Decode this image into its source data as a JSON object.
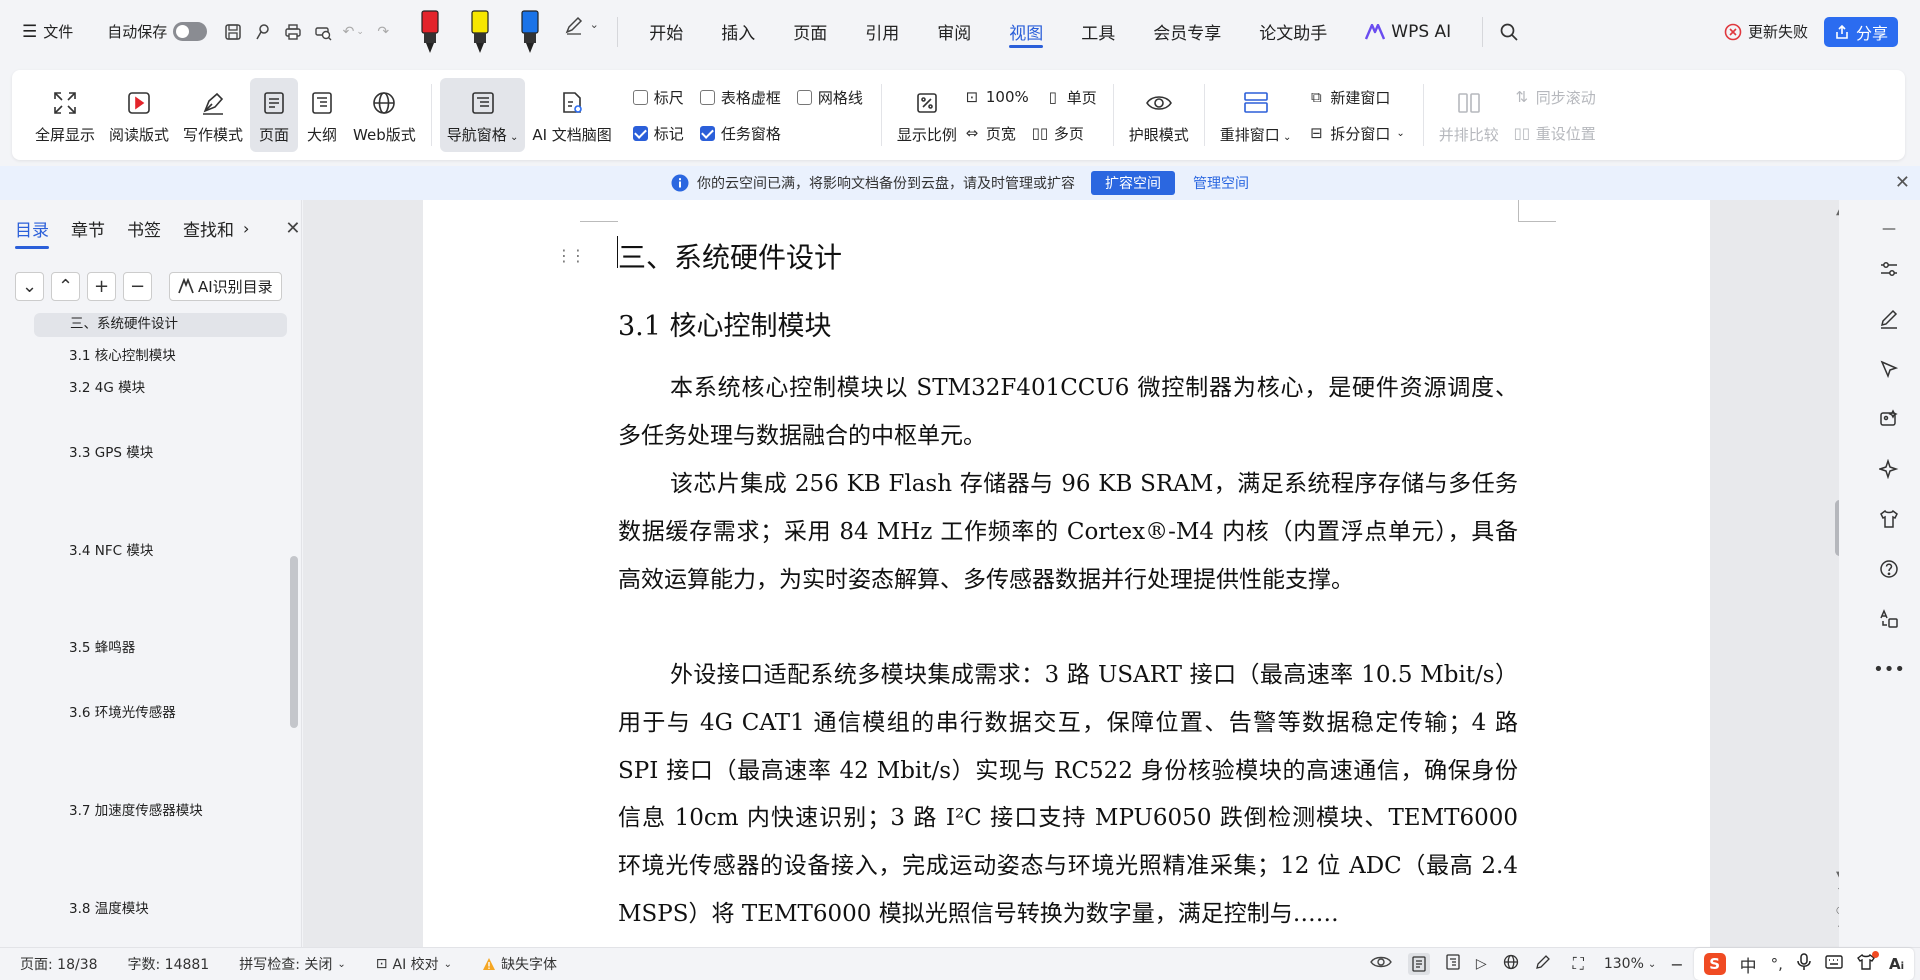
{
  "menubar": {
    "file_label": "文件",
    "autosave_label": "自动保存",
    "tabs": [
      "开始",
      "插入",
      "页面",
      "引用",
      "审阅",
      "视图",
      "工具",
      "会员专享",
      "论文助手",
      "WPS AI"
    ],
    "active_tab": "视图",
    "update_failed_label": "更新失败",
    "share_label": "分享",
    "share_color": "#2b6cf0",
    "accent_color": "#2b5fd9"
  },
  "ribbon": {
    "fullscreen": "全屏显示",
    "reading_mode": "阅读版式",
    "writing_mode": "写作模式",
    "page": "页面",
    "outline": "大纲",
    "web_layout": "Web版式",
    "nav_pane": "导航窗格",
    "ai_mindmap": "AI 文档脑图",
    "ruler": "标尺",
    "table_gridlines": "表格虚框",
    "gridlines": "网格线",
    "markup": "标记",
    "task_pane": "任务窗格",
    "zoom_ratio": "显示比例",
    "zoom_100": "100%",
    "page_width": "页宽",
    "single_page": "单页",
    "multi_page": "多页",
    "eye_protection": "护眼模式",
    "rearrange_windows": "重排窗口",
    "new_window": "新建窗口",
    "split_window": "拆分窗口",
    "side_by_side": "并排比较",
    "sync_scroll": "同步滚动",
    "reset_position": "重设位置"
  },
  "notice": {
    "text": "你的云空间已满，将影响文档备份到云盘，请及时管理或扩容",
    "expand_button": "扩容空间",
    "manage_link": "管理空间"
  },
  "nav": {
    "tabs": [
      "目录",
      "章节",
      "书签",
      "查找和"
    ],
    "active_tab": "目录",
    "ai_toc_button": "AI识别目录",
    "toc": [
      "三、系统硬件设计",
      "3.1  核心控制模块",
      "3.2 4G 模块",
      "3.3 GPS 模块",
      "3.4 NFC 模块",
      "3.5  蜂鸣器",
      "3.6  环境光传感器",
      "3.7  加速度传感器模块",
      "3.8  温度模块"
    ]
  },
  "document": {
    "heading1": "三、系统硬件设计",
    "heading2": "3.1  核心控制模块",
    "paragraphs": [
      "本系统核心控制模块以 STM32F401CCU6 微控制器为核心，是硬件资源调度、多任务处理与数据融合的中枢单元。",
      "该芯片集成 256 KB Flash 存储器与 96 KB SRAM，满足系统程序存储与多任务数据缓存需求；采用 84 MHz 工作频率的 Cortex®-M4 内核（内置浮点单元），具备高效运算能力，为实时姿态解算、多传感器数据并行处理提供性能支撑。",
      "外设接口适配系统多模块集成需求：3 路 USART 接口（最高速率 10.5 Mbit/s）用于与 4G CAT1 通信模组的串行数据交互，保障位置、告警等数据稳定传输；4 路 SPI 接口（最高速率 42 Mbit/s）实现与 RC522 身份核验模块的高速通信，确保身份信息 10cm 内快速识别；3 路 I²C 接口支持 MPU6050 跌倒检测模块、TEMT6000 环境光传感器的设备接入，完成运动姿态与环境光照精准采集；12 位 ADC（最高 2.4 MSPS）将 TEMT6000 模拟光照信号转换为数字量，满足控制与……"
    ]
  },
  "status": {
    "page": "页面: 18/38",
    "word_count": "字数: 14881",
    "spellcheck": "拼写检查: 关闭",
    "ai_proofread": "AI 校对",
    "missing_fonts": "缺失字体",
    "zoom": "130%",
    "ime_chinese": "中"
  }
}
